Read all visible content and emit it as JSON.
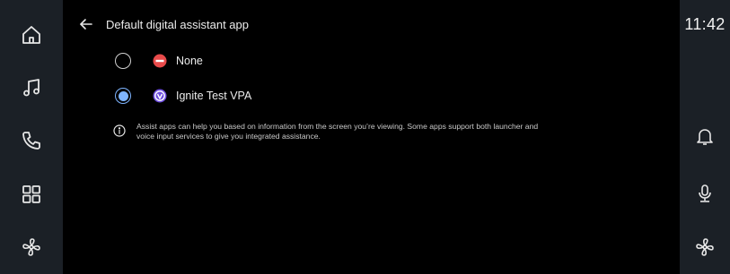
{
  "status_bar": {
    "time": "11:42"
  },
  "left_rail": {
    "items": [
      {
        "icon": "home-icon"
      },
      {
        "icon": "music-icon"
      },
      {
        "icon": "phone-icon"
      },
      {
        "icon": "apps-grid-icon"
      },
      {
        "icon": "fan-icon"
      }
    ]
  },
  "right_rail": {
    "items": [
      {
        "icon": "bell-icon"
      },
      {
        "icon": "microphone-icon"
      },
      {
        "icon": "fan-icon"
      }
    ]
  },
  "header": {
    "title": "Default digital assistant app"
  },
  "options": [
    {
      "label": "None",
      "selected": false,
      "icon": "none-icon"
    },
    {
      "label": "Ignite Test VPA",
      "selected": true,
      "icon": "vpa-app-icon"
    }
  ],
  "info": {
    "text_line1": "Assist apps can help you based on information from the screen you’re viewing. Some apps support both launcher and",
    "text_line2": "voice input services to give you integrated assistance."
  },
  "colors": {
    "rail_background": "#1b2026",
    "radio_accent": "#7eb4ff",
    "none_icon_red": "#e84a4a",
    "vpa_icon_purple": "#6f4fe0"
  }
}
